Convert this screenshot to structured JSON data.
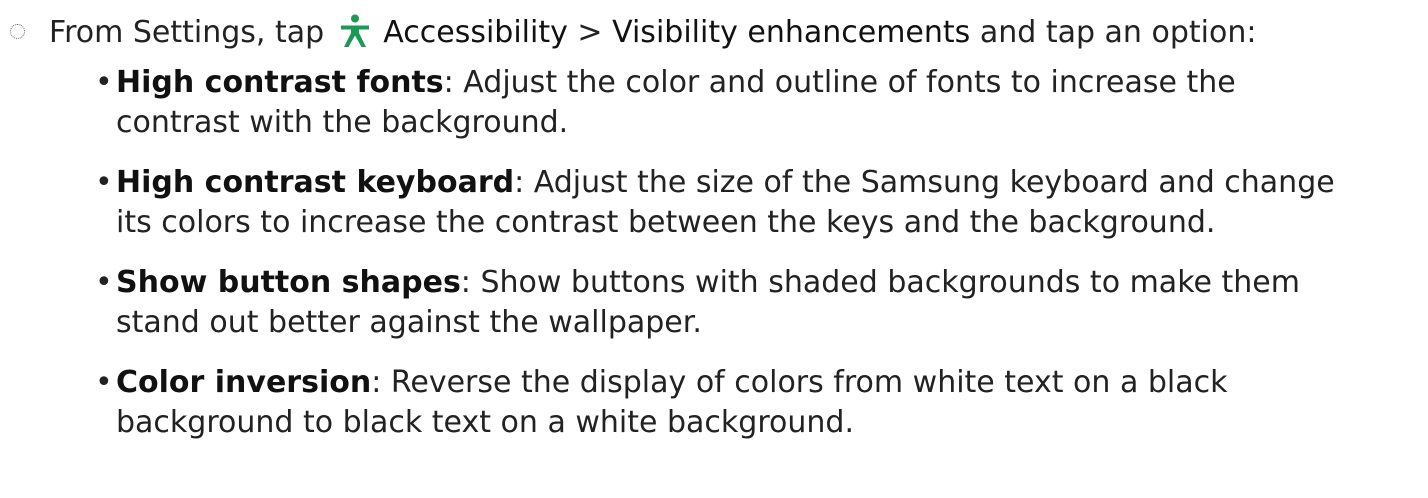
{
  "instruction": {
    "prefix": "From Settings, tap",
    "icon": "accessibility-icon",
    "accent_color": "#1a9a55",
    "menu_item": "Accessibility",
    "separator": ">",
    "submenu_item": "Visibility enhancements",
    "suffix": "and tap an option:"
  },
  "options": [
    {
      "term": "High contrast fonts",
      "description": ": Adjust the color and outline of fonts to increase the",
      "description_cont": "contrast with the background."
    },
    {
      "term": "High contrast keyboard",
      "description": ": Adjust the size of the Samsung keyboard and change",
      "description_cont": "its colors to increase the contrast between the keys and the background."
    },
    {
      "term": "Show button shapes",
      "description": ": Show buttons with shaded backgrounds to make them",
      "description_cont": "stand out better against the wallpaper."
    },
    {
      "term": "Color inversion",
      "description": ": Reverse the display of colors from white text on a black",
      "description_cont": "background to black text on a white background."
    }
  ],
  "bullet_char": "•"
}
